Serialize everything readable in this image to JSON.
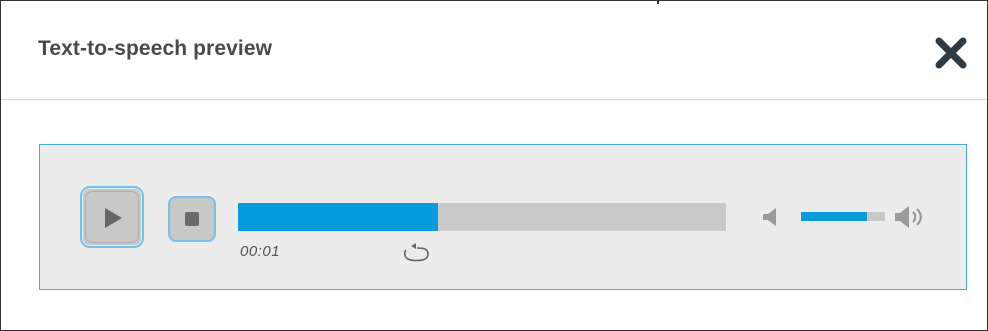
{
  "dialog": {
    "title": "Text-to-speech preview",
    "close_icon": "close-x-icon"
  },
  "player": {
    "play_icon": "play-icon",
    "stop_icon": "stop-icon",
    "time_elapsed": "00:01",
    "progress_fraction": 0.41,
    "repeat_icon": "repeat-icon",
    "volume_low_icon": "volume-low-icon",
    "volume_high_icon": "volume-high-icon",
    "volume_fraction": 0.79
  },
  "colors": {
    "accent": "#0a9bdc",
    "player_border": "#4aa8dc",
    "track": "#c9c9c9",
    "title_text": "#4a4a4a"
  }
}
